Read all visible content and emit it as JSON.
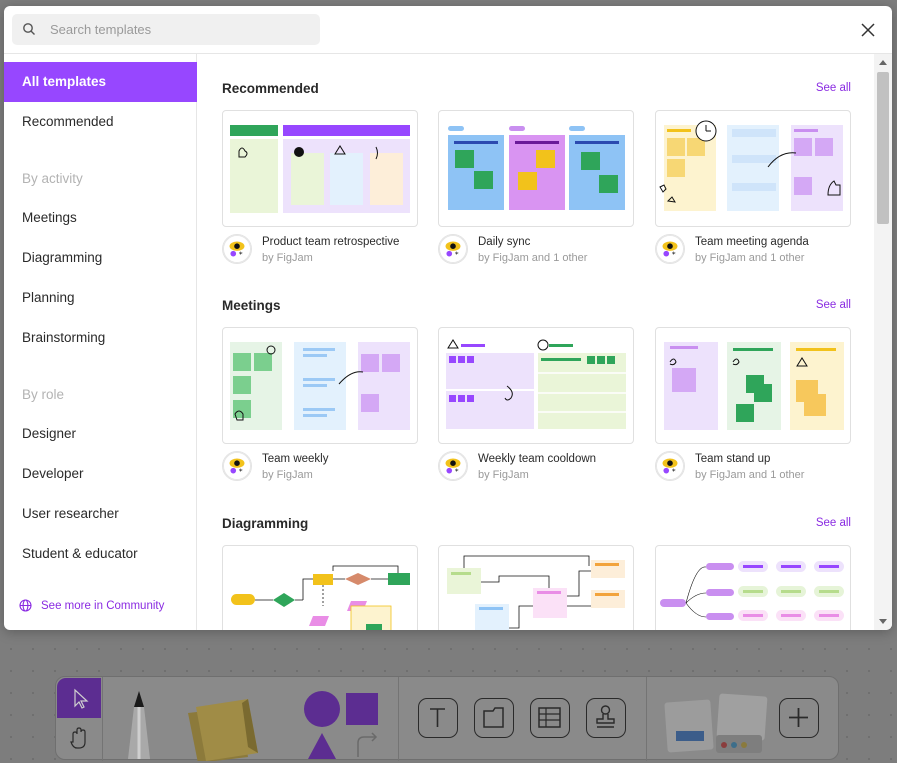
{
  "search": {
    "placeholder": "Search templates",
    "value": ""
  },
  "sidebar": {
    "items": [
      {
        "label": "All templates",
        "active": true
      },
      {
        "label": "Recommended"
      }
    ],
    "activity_heading": "By activity",
    "activity_items": [
      "Meetings",
      "Diagramming",
      "Planning",
      "Brainstorming"
    ],
    "role_heading": "By role",
    "role_items": [
      "Designer",
      "Developer",
      "User researcher",
      "Student & educator"
    ],
    "community_link": "See more in Community"
  },
  "sections": [
    {
      "title": "Recommended",
      "see_all": "See all",
      "cards": [
        {
          "title": "Product team retrospective",
          "author": "by FigJam"
        },
        {
          "title": "Daily sync",
          "author": "by FigJam and 1 other"
        },
        {
          "title": "Team meeting agenda",
          "author": "by FigJam and 1 other"
        }
      ]
    },
    {
      "title": "Meetings",
      "see_all": "See all",
      "cards": [
        {
          "title": "Team weekly",
          "author": "by FigJam"
        },
        {
          "title": "Weekly team cooldown",
          "author": "by FigJam"
        },
        {
          "title": "Team stand up",
          "author": "by FigJam and 1 other"
        }
      ]
    },
    {
      "title": "Diagramming",
      "see_all": "See all",
      "cards": []
    }
  ],
  "toolbar": {
    "tools": [
      "move-tool",
      "hand-tool",
      "marker-tool",
      "sticky-note-tool",
      "shapes-tool",
      "text-tool",
      "section-tool",
      "table-tool",
      "stamp-tool",
      "widgets-tool",
      "add-button"
    ]
  },
  "colors": {
    "accent": "#9747ff",
    "link": "#8a2be2",
    "green": "#2fa55a",
    "yellow": "#f2c21b",
    "purple_light": "#ede2fc",
    "blue": "#8ec3f5"
  }
}
